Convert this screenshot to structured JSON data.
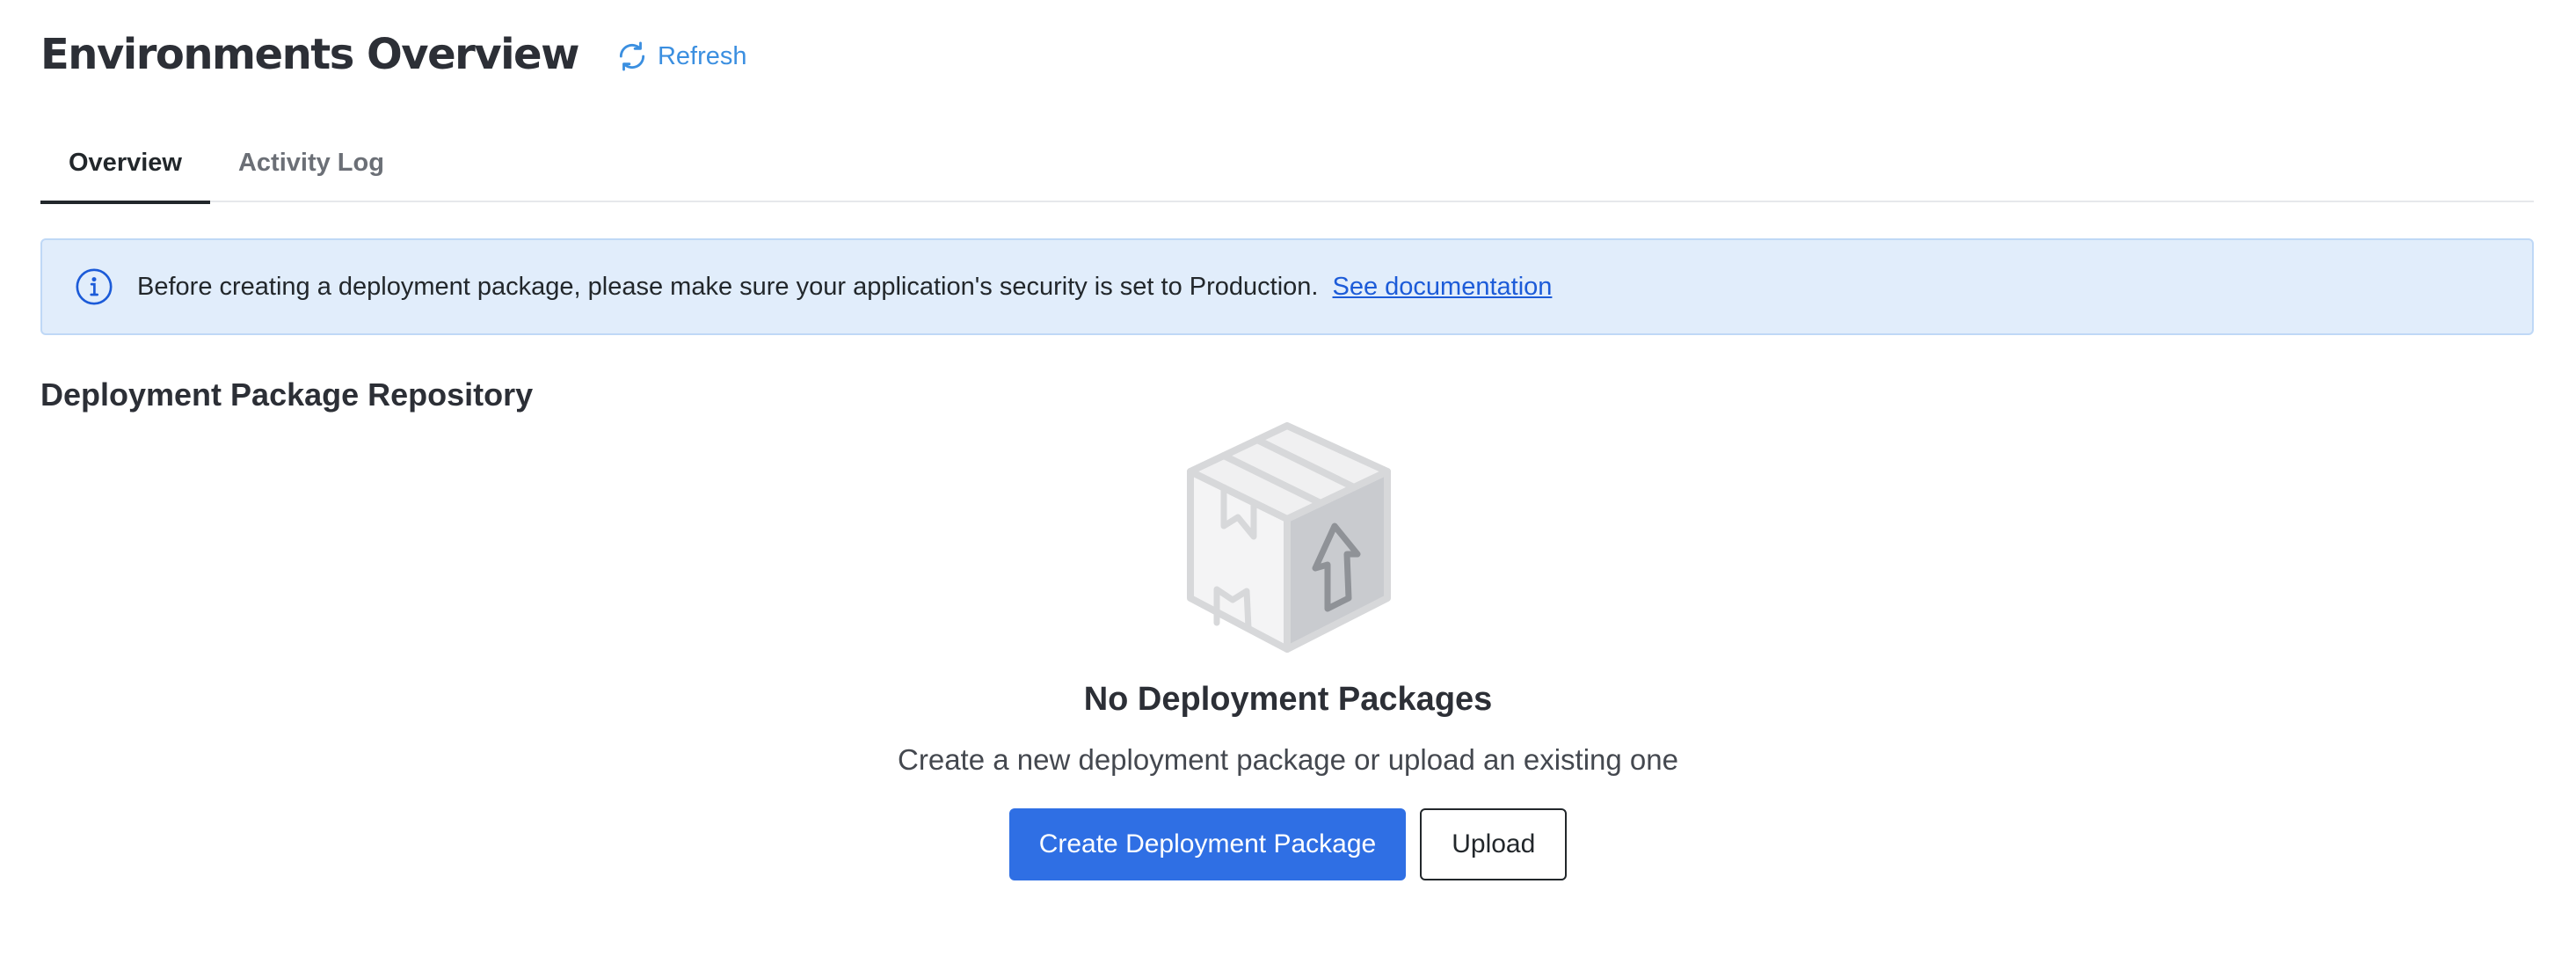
{
  "header": {
    "title": "Environments Overview",
    "refresh_label": "Refresh",
    "refresh_icon": "refresh-icon"
  },
  "tabs": [
    {
      "label": "Overview",
      "active": true
    },
    {
      "label": "Activity Log",
      "active": false
    }
  ],
  "banner": {
    "icon": "info-icon",
    "message": "Before creating a deployment package, please make sure your application's security is set to Production.",
    "link_label": "See documentation"
  },
  "section": {
    "title": "Deployment Package Repository"
  },
  "empty_state": {
    "illustration": "package-box-icon",
    "title": "No Deployment Packages",
    "subtitle": "Create a new deployment package or upload an existing one",
    "primary_button": "Create Deployment Package",
    "secondary_button": "Upload"
  },
  "colors": {
    "accent": "#2f6fe4",
    "link": "#1c5bd8",
    "refresh": "#3b8fe0",
    "banner_bg": "#e1edfb",
    "banner_border": "#bfd8f6"
  }
}
